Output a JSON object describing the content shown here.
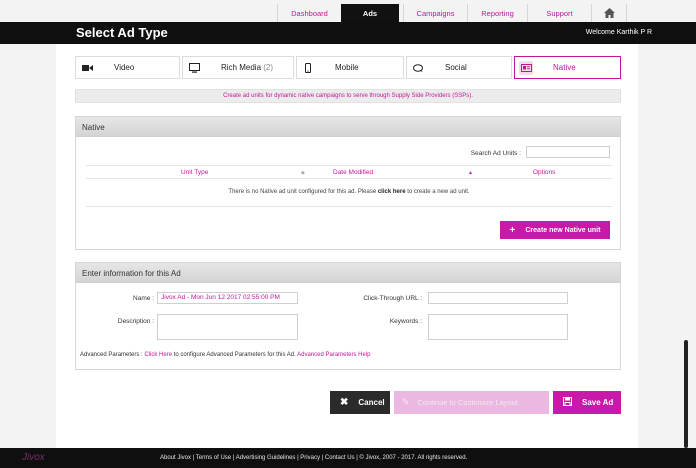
{
  "nav": {
    "tabs": [
      "Dashboard",
      "Ads",
      "Campaigns",
      "Reporting",
      "Support"
    ],
    "active": "Ads",
    "home_icon": "home-icon"
  },
  "header": {
    "title": "Select Ad Type",
    "welcome": "Welcome Karthik P R"
  },
  "ad_types": {
    "video": {
      "label": "Video",
      "icon": "video-camera-icon"
    },
    "rich": {
      "label": "Rich Media",
      "count": "(2)",
      "icon": "monitor-icon"
    },
    "mobile": {
      "label": "Mobile",
      "icon": "mobile-icon"
    },
    "social": {
      "label": "Social",
      "icon": "chat-bubble-icon"
    },
    "native": {
      "label": "Native",
      "icon": "id-card-icon"
    },
    "active": "Native",
    "accent": "#c0179a"
  },
  "info_line": "Create ad units for dynamic native campaigns to serve through Supply Side Providers (SSPs).",
  "native_panel": {
    "title": "Native",
    "search_label": "Search Ad Units :",
    "search_value": "",
    "columns": [
      "Unit Type",
      "Date Modified",
      "Options"
    ],
    "empty_prefix": "There is no Native ad unit configured for this ad. Please ",
    "empty_link": "click here",
    "empty_suffix": " to create a new ad unit.",
    "create_button": "Create new Native unit"
  },
  "info_panel": {
    "title": "Enter information for this Ad",
    "name_label": "Name :",
    "name_value": "Jivox Ad - Mon Jun 12 2017 02:55:00 PM",
    "description_label": "Description :",
    "description_value": "",
    "ctu_label": "Click-Through URL :",
    "ctu_value": "",
    "keywords_label": "Keywords :",
    "keywords_value": "",
    "adv_prefix": "Advanced Parameters : ",
    "adv_link": "Click Here",
    "adv_middle": " to configure Advanced Parameters for this Ad. ",
    "adv_help": "Advanced Parameters Help"
  },
  "actions": {
    "cancel": "Cancel",
    "continue": "Continue to Customize Layout",
    "save": "Save Ad"
  },
  "footer": {
    "logo": "Jivox",
    "links": "About Jivox | Terms of Use | Advertising Guidelines | Privacy | Contact Us | © Jivox, 2007 - 2017. All rights reserved."
  }
}
